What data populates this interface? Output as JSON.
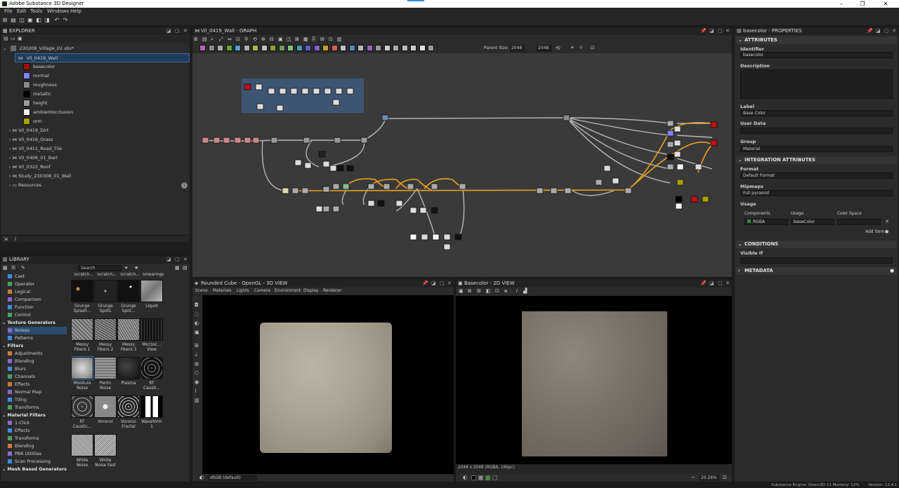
{
  "app": {
    "title": "Adobe Substance 3D Designer"
  },
  "menu": [
    "File",
    "Edit",
    "Tools",
    "Windows",
    "Help"
  ],
  "explorer": {
    "title": "EXPLORER",
    "file": "230209_Village_01.sbs*",
    "graph": "Vil_0419_Wall",
    "outputs": [
      "basecolor",
      "normal",
      "roughness",
      "metallic",
      "height",
      "ambientocclusion",
      "orm"
    ],
    "graphs": [
      "Vil_0419_Dirt",
      "Vil_0416_Grass",
      "Vil_0411_Road_Tile",
      "Vil_0406_01_Barl",
      "Vil_0322_Roof",
      "Study_230308_01_Wall"
    ],
    "resources": "Resources"
  },
  "library": {
    "title": "LIBRARY",
    "search_placeholder": "Search",
    "categories": [
      {
        "label": "Cast",
        "type": "item"
      },
      {
        "label": "Operator",
        "type": "item"
      },
      {
        "label": "Logical",
        "type": "item"
      },
      {
        "label": "Comparison",
        "type": "item"
      },
      {
        "label": "Function",
        "type": "item"
      },
      {
        "label": "Control",
        "type": "item"
      },
      {
        "label": "Texture Generators",
        "type": "head"
      },
      {
        "label": "Noises",
        "type": "sel"
      },
      {
        "label": "Patterns",
        "type": "item"
      },
      {
        "label": "Filters",
        "type": "head"
      },
      {
        "label": "Adjustments",
        "type": "item"
      },
      {
        "label": "Blending",
        "type": "item"
      },
      {
        "label": "Blurs",
        "type": "item"
      },
      {
        "label": "Channels",
        "type": "item"
      },
      {
        "label": "Effects",
        "type": "item"
      },
      {
        "label": "Normal Map",
        "type": "item"
      },
      {
        "label": "Tiling",
        "type": "item"
      },
      {
        "label": "Transforms",
        "type": "item"
      },
      {
        "label": "Material Filters",
        "type": "head"
      },
      {
        "label": "1-Click",
        "type": "item"
      },
      {
        "label": "Effects",
        "type": "item"
      },
      {
        "label": "Transforms",
        "type": "item"
      },
      {
        "label": "Blending",
        "type": "item"
      },
      {
        "label": "PBR Utilities",
        "type": "item"
      },
      {
        "label": "Scan Processing",
        "type": "item"
      },
      {
        "label": "Mesh Based Generators",
        "type": "head"
      }
    ],
    "top_partial": [
      "Scratch...",
      "Scratch...",
      "Scratch...",
      "Smearings"
    ],
    "thumbs": [
      [
        "Grunge",
        "Splash..."
      ],
      [
        "Grunge",
        "Spots"
      ],
      [
        "Grunge",
        "Spot..."
      ],
      [
        "Liquid",
        ""
      ],
      [
        "Messy",
        "Fibers 1"
      ],
      [
        "Messy",
        "Fibers 2"
      ],
      [
        "Messy",
        "Fibers 3"
      ],
      [
        "Microsc...",
        "View"
      ],
      [
        "Moisture",
        "Noise"
      ],
      [
        "Perlin",
        "Noise"
      ],
      [
        "Plasma",
        ""
      ],
      [
        "RT",
        "Causti..."
      ],
      [
        "RT",
        "Caustic..."
      ],
      [
        "Voronoi",
        ""
      ],
      [
        "Voronoi",
        "Fractal"
      ],
      [
        "Waveform",
        "1"
      ],
      [
        "White",
        "Noise"
      ],
      [
        "White",
        "Noise Fast"
      ]
    ]
  },
  "graph": {
    "title": "Vil_0419_Wall - GRAPH",
    "parent_size_label": "Parent Size:",
    "size_a": "2048",
    "size_b": "2048"
  },
  "view3d": {
    "title": "Rounded Cube - OpenGL - 3D VIEW",
    "menu": [
      "Scene",
      "Materials",
      "Lights",
      "Camera",
      "Environment",
      "Display",
      "Renderer"
    ],
    "colorspace": "sRGB (default)"
  },
  "view2d": {
    "title": "Basecolor - 2D VIEW",
    "info": "2048 x 2048 (RGBA, 16bpc)",
    "zoom": "20.26%"
  },
  "properties": {
    "title": "basecolor - PROPERTIES",
    "attributes": "ATTRIBUTES",
    "identifier_label": "Identifier",
    "identifier": "basecolor",
    "description_label": "Description",
    "label_label": "Label",
    "label": "Base Color",
    "userdata_label": "User Data",
    "group_label": "Group",
    "group": "Material",
    "integration": "INTEGRATION ATTRIBUTES",
    "format_label": "Format",
    "format": "Default Format",
    "mipmaps_label": "Mipmaps",
    "mipmaps": "Full pyramid",
    "usage_label": "Usage",
    "col_components": "Components",
    "col_usage": "Usage",
    "col_colorspace": "Color Space",
    "components": "RGBA",
    "usage": "baseColor",
    "add_item": "Add Item",
    "conditions": "CONDITIONS",
    "visible_if": "Visible If",
    "metadata": "METADATA"
  },
  "status": {
    "text": "Substance Engine: Direct3D 11  Memory: 12%",
    "version": "Version: 12.4.1"
  },
  "colors": {
    "accent": "#3a6fa8",
    "orange_link": "#e8a020",
    "graph_bg": "#3a3a3a"
  }
}
